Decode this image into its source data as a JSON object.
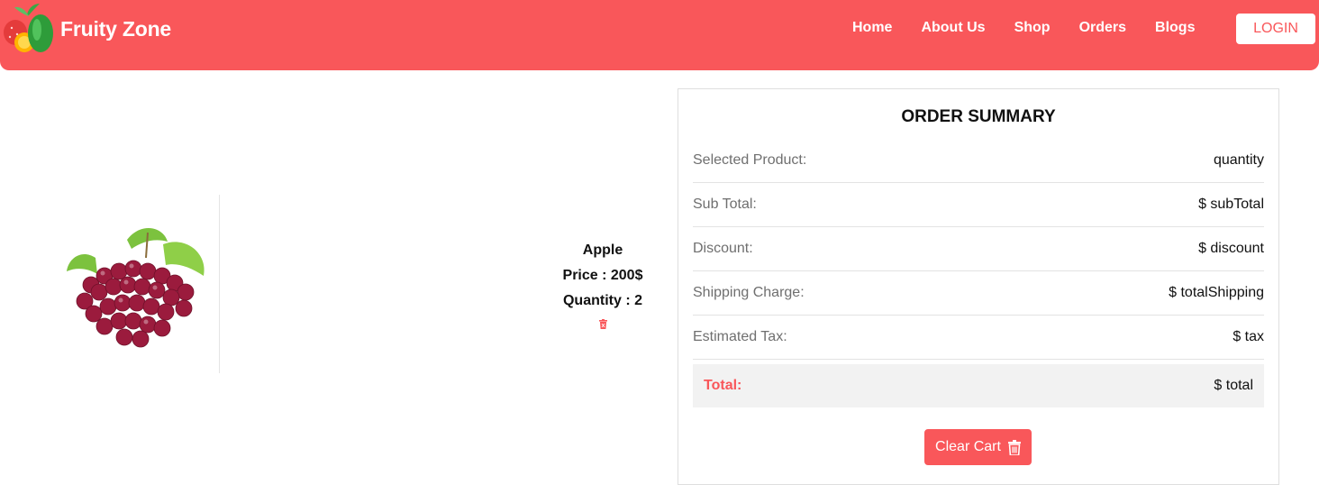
{
  "brand": {
    "name": "Fruity Zone",
    "logo_icon": "fruit-logo-icon"
  },
  "nav": {
    "links": [
      "Home",
      "About Us",
      "Shop",
      "Orders",
      "Blogs"
    ],
    "login_label": "LOGIN"
  },
  "colors": {
    "accent": "#f9575a",
    "total_bg": "#f2f2f2"
  },
  "cart": {
    "items": [
      {
        "name": "Apple",
        "price": "Price : 200$",
        "quantity": "Quantity : 2",
        "image": "red-grapes-image",
        "delete_icon": "trash-icon"
      }
    ]
  },
  "summary": {
    "title": "ORDER SUMMARY",
    "rows": [
      {
        "label": "Selected Product:",
        "value": "quantity"
      },
      {
        "label": "Sub Total:",
        "value": "$ subTotal"
      },
      {
        "label": "Discount:",
        "value": "$ discount"
      },
      {
        "label": "Shipping Charge:",
        "value": "$ totalShipping"
      },
      {
        "label": "Estimated Tax:",
        "value": "$ tax"
      }
    ],
    "total": {
      "label": "Total:",
      "value": "$ total"
    },
    "clear_label": "Clear Cart",
    "clear_icon": "trash-icon"
  }
}
